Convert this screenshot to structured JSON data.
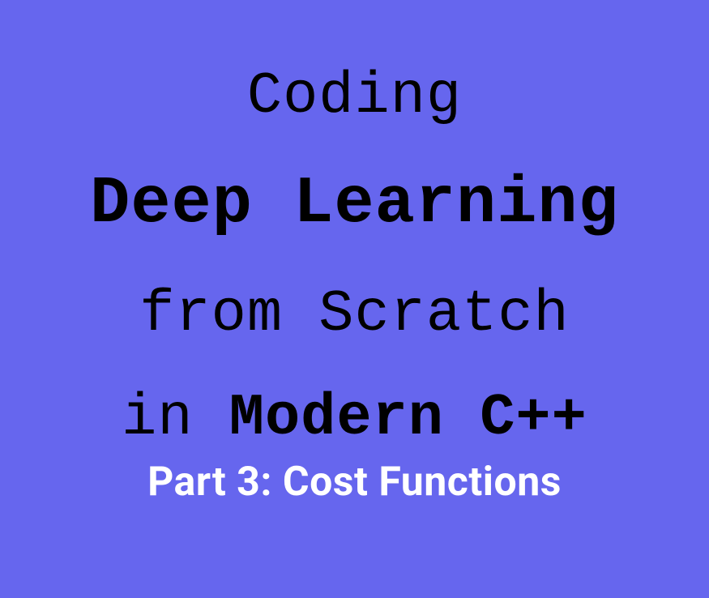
{
  "header": {
    "line1": "Coding",
    "line2": "Deep Learning",
    "line3": "from Scratch",
    "line4_thin": "in ",
    "line4_bold": "Modern C++",
    "subtitle": "Part 3: Cost Functions"
  }
}
